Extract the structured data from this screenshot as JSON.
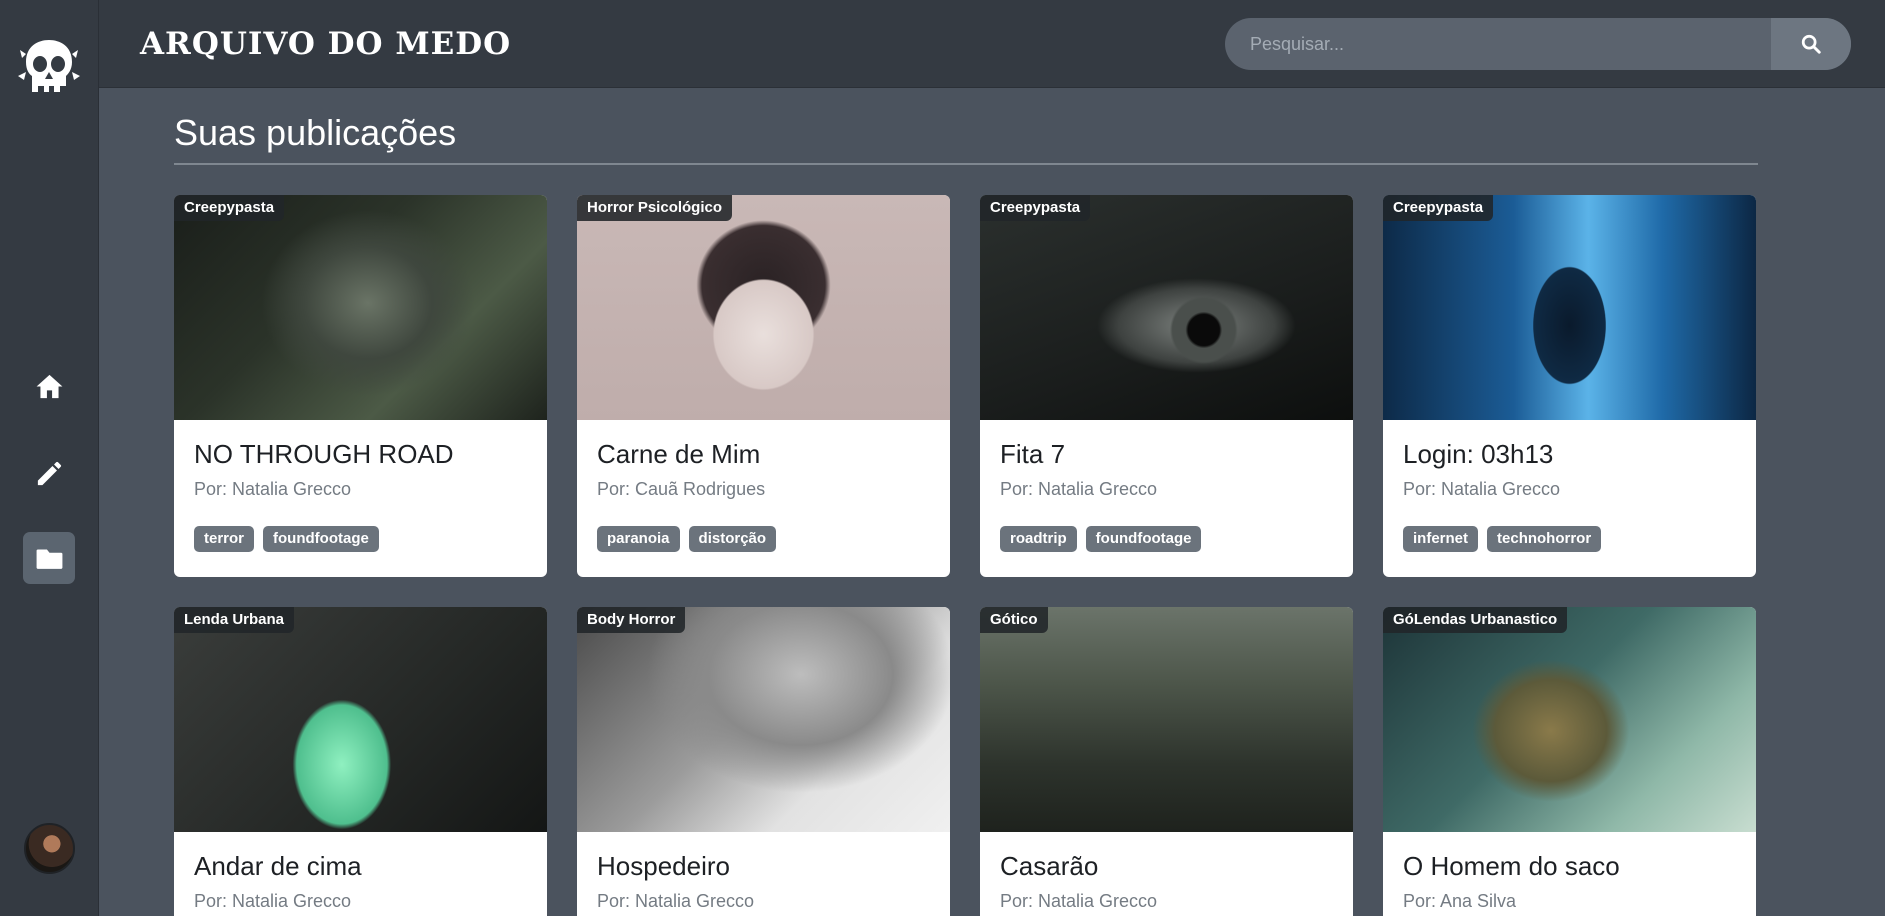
{
  "app": {
    "brand": "ARQUIVO DO MEDO"
  },
  "search": {
    "placeholder": "Pesquisar..."
  },
  "nav": {
    "items": [
      "home-icon",
      "pencil-icon",
      "folder-icon"
    ],
    "active": "folder-icon"
  },
  "page": {
    "title": "Suas publicações"
  },
  "colors": {
    "sidebar": "#343a42",
    "background": "#4b535e",
    "badge": "#212529",
    "tag": "#6b737c"
  },
  "posts": [
    {
      "category": "Creepypasta",
      "title": "NO THROUGH ROAD",
      "author": "Por: Natalia Grecco",
      "tags": [
        "terror",
        "foundfootage"
      ]
    },
    {
      "category": "Horror Psicológico",
      "title": "Carne de Mim",
      "author": "Por: Cauã Rodrigues",
      "tags": [
        "paranoia",
        "distorção"
      ]
    },
    {
      "category": "Creepypasta",
      "title": "Fita 7",
      "author": "Por: Natalia Grecco",
      "tags": [
        "roadtrip",
        "foundfootage"
      ]
    },
    {
      "category": "Creepypasta",
      "title": "Login: 03h13",
      "author": "Por: Natalia Grecco",
      "tags": [
        "infernet",
        "technohorror"
      ]
    },
    {
      "category": "Lenda Urbana",
      "title": "Andar de cima",
      "author": "Por: Natalia Grecco",
      "tags": []
    },
    {
      "category": "Body Horror",
      "title": "Hospedeiro",
      "author": "Por: Natalia Grecco",
      "tags": []
    },
    {
      "category": "Gótico",
      "title": "Casarão",
      "author": "Por: Natalia Grecco",
      "tags": []
    },
    {
      "category": "GóLendas Urbanastico",
      "title": "O Homem do saco",
      "author": "Por: Ana Silva",
      "tags": []
    }
  ]
}
